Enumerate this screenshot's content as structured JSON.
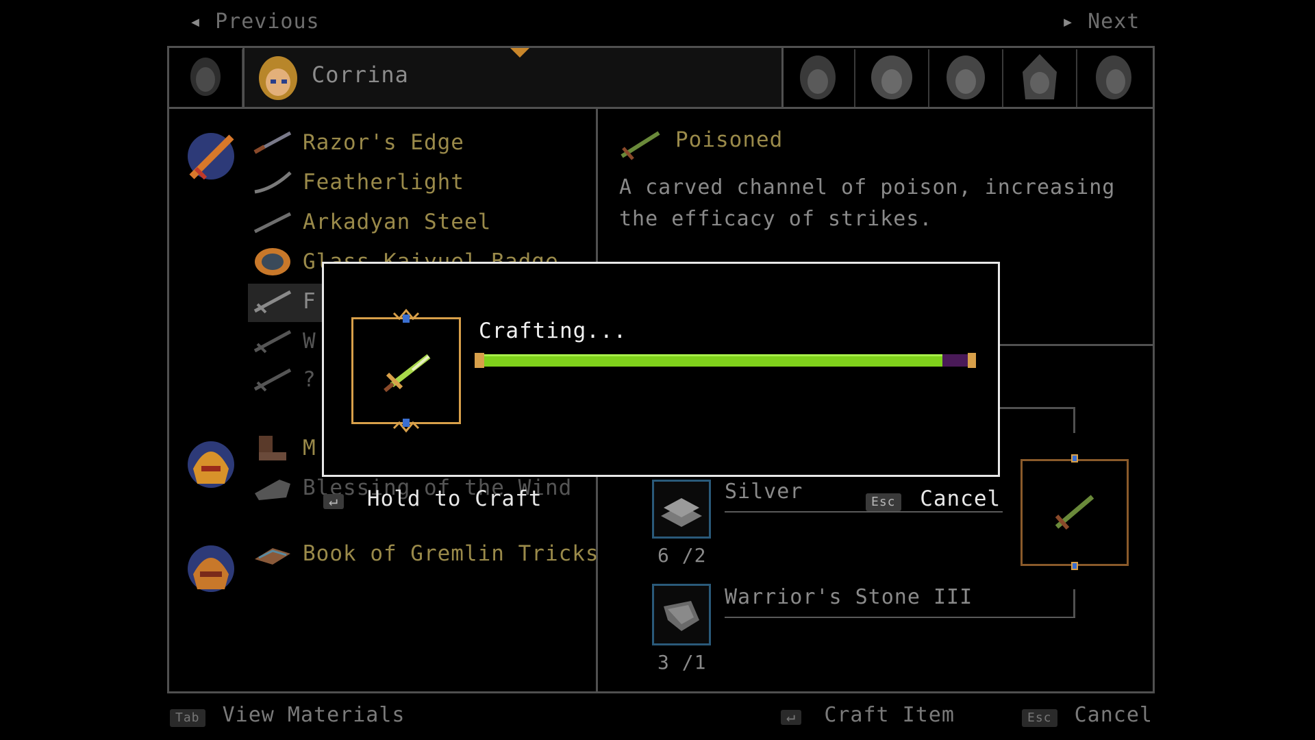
{
  "nav": {
    "previous_label": "Previous",
    "next_label": "Next"
  },
  "party": {
    "selected_name": "Corrina",
    "members": [
      "portrait-1",
      "portrait-2",
      "portrait-3",
      "portrait-4",
      "portrait-5"
    ]
  },
  "recipes": {
    "weapon_items": [
      "Razor's Edge",
      "Featherlight",
      "Arkadyan Steel",
      "Glass Kaiyuel Badge",
      "F",
      "W",
      "?"
    ],
    "armor_items": [
      "M",
      "Blessing of the Wind"
    ],
    "book_items": [
      "Book of Gremlin Tricks"
    ]
  },
  "detail": {
    "title": "Poisoned",
    "description_line1": "A carved channel of poison, increasing",
    "description_line2": "the efficacy of strikes."
  },
  "materials": [
    {
      "name": "Silver",
      "count": "6 /2"
    },
    {
      "name": "Warrior's Stone III",
      "count": "3 /1"
    }
  ],
  "crafting_dialog": {
    "title": "Crafting...",
    "progress": 0.94,
    "colors": {
      "bar_fill": "#7fd11b",
      "bar_empty": "#4a1a58",
      "frame_gold": "#d8a04a"
    }
  },
  "hold_to_craft": {
    "key": "↵",
    "label": "Hold to Craft"
  },
  "dialog_cancel": {
    "key": "Esc",
    "label": "Cancel"
  },
  "footer": {
    "view_key": "Tab",
    "view_label": "View Materials",
    "craft_key": "↵",
    "craft_label": "Craft Item",
    "cancel_key": "Esc",
    "cancel_label": "Cancel"
  }
}
